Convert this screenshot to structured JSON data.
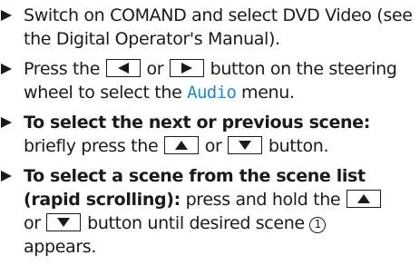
{
  "steps": [
    {
      "text": "Switch on COMAND and select DVD Video (see the Digital Operator's Manual)."
    },
    {
      "text_before": "Press the",
      "connector": "or",
      "text_after": "button on the steering wheel to select the",
      "display_word": "Audio",
      "text_end": "menu.",
      "keys": [
        "arrow-left",
        "arrow-right"
      ]
    },
    {
      "heading": "To select the next or previous scene:",
      "text_before": "briefly press the",
      "connector": "or",
      "text_after": "button.",
      "keys": [
        "arrow-up",
        "arrow-down"
      ]
    },
    {
      "heading": "To select a scene from the scene list (rapid scrolling):",
      "text_before": "press and hold the",
      "connector": "or",
      "text_after": "button until desired scene",
      "callout_number": "1",
      "text_end": "appears.",
      "keys": [
        "arrow-up",
        "arrow-down"
      ]
    }
  ],
  "colors": {
    "text": "#1a1a1a",
    "display_word": "#1e88c8"
  },
  "icons": {
    "step_bullet": "triangle-right-icon",
    "keys": [
      "arrow-left-icon",
      "arrow-right-icon",
      "arrow-up-icon",
      "arrow-down-icon"
    ]
  }
}
